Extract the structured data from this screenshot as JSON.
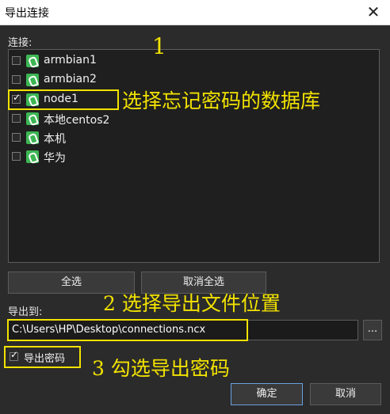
{
  "window": {
    "title": "导出连接",
    "close_glyph": "✕"
  },
  "connections": {
    "label": "连接:",
    "items": [
      {
        "name": "armbian1",
        "checked": false
      },
      {
        "name": "armbian2",
        "checked": false
      },
      {
        "name": "node1",
        "checked": true
      },
      {
        "name": "本地centos2",
        "checked": false
      },
      {
        "name": "本机",
        "checked": false
      },
      {
        "name": "华为",
        "checked": false
      }
    ]
  },
  "buttons": {
    "select_all": "全选",
    "deselect_all": "取消全选",
    "ok": "确定",
    "cancel": "取消",
    "browse": "..."
  },
  "export": {
    "label": "导出到:",
    "path": "C:\\Users\\HP\\Desktop\\connections.ncx"
  },
  "export_password": {
    "label": "导出密码",
    "checked": true
  },
  "annotations": {
    "step1_number": "1",
    "step1_text": "选择忘记密码的数据库",
    "step2_text": "2 选择导出文件位置",
    "step3_text": "3 勾选导出密码",
    "color": "#f2e200"
  },
  "colors": {
    "background": "#2b2b2b",
    "list_background": "#1f1f1f",
    "db_icon": "#3db654",
    "primary_border": "#6aa0e0"
  }
}
